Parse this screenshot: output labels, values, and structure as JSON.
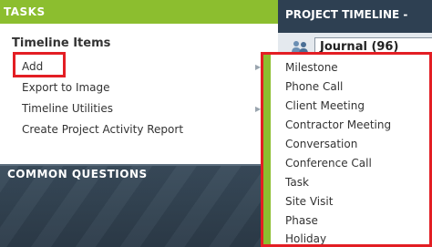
{
  "tasks": {
    "header": "TASKS",
    "section_title": "Timeline Items",
    "items": [
      {
        "label": "Add",
        "has_submenu": true
      },
      {
        "label": "Export to Image",
        "has_submenu": false
      },
      {
        "label": "Timeline Utilities",
        "has_submenu": true
      },
      {
        "label": "Create Project Activity Report",
        "has_submenu": false
      }
    ],
    "arrow": "▶"
  },
  "common_questions": {
    "header": "COMMON QUESTIONS"
  },
  "timeline": {
    "header": "PROJECT TIMELINE -",
    "journal_tab": "Journal (96)",
    "icon": "people-icon"
  },
  "submenu": {
    "items": [
      "Milestone",
      "Phone Call",
      "Client Meeting",
      "Contractor Meeting",
      "Conversation",
      "Conference Call",
      "Task",
      "Site Visit",
      "Phase",
      "Holiday"
    ]
  },
  "colors": {
    "accent_green": "#8cbe2f",
    "dark_panel": "#2e4052",
    "highlight_red": "#e31e24"
  }
}
